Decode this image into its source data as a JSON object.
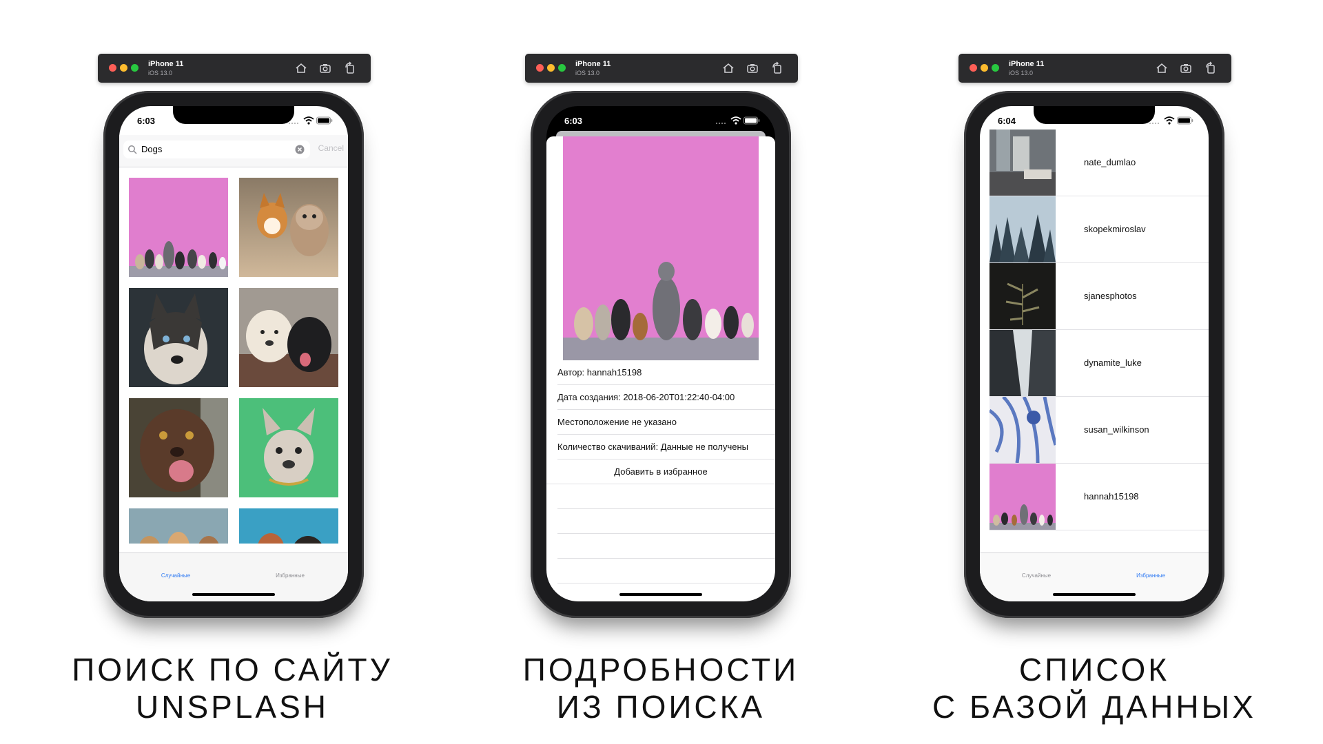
{
  "simulator": {
    "device": "iPhone 11",
    "os": "iOS 13.0"
  },
  "screens": [
    {
      "time": "6:03",
      "search": {
        "query": "Dogs",
        "cancel": "Cancel"
      },
      "tabs": [
        "Случайные",
        "Избранные"
      ],
      "active_tab": 0,
      "caption": [
        "ПОИСК ПО САЙТУ",
        "UNSPLASH"
      ]
    },
    {
      "time": "6:03",
      "details": [
        "Автор: hannah15198",
        "Дата создания: 2018-06-20T01:22:40-04:00",
        "Местоположение не указано",
        "Количество скачиваний: Данные не получены"
      ],
      "favorite_button": "Добавить в избранное",
      "caption": [
        "ПОДРОБНОСТИ",
        "ИЗ ПОИСКА"
      ]
    },
    {
      "time": "6:04",
      "favorites": [
        "nate_dumlao",
        "skopekmiroslav",
        "sjanesphotos",
        "dynamite_luke",
        "susan_wilkinson",
        "hannah15198"
      ],
      "tabs": [
        "Случайные",
        "Избранные"
      ],
      "active_tab": 1,
      "caption": [
        "СПИСОК",
        "С БАЗОЙ ДАННЫХ"
      ]
    }
  ],
  "colors": {
    "accent": "#2f7af3",
    "pink_wall": "#e27fcf",
    "green_bg": "#4cbf7a"
  }
}
